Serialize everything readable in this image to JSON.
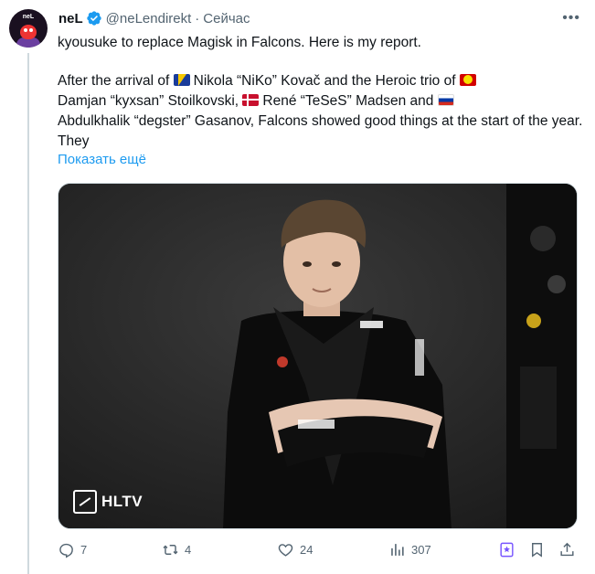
{
  "author": {
    "display_name": "neL",
    "handle": "@neLendirekt",
    "separator": "·",
    "timestamp": "Сейчас",
    "avatar_text": "neL"
  },
  "tweet": {
    "line1": "kyousuke to replace Magisk in Falcons. Here is my report.",
    "para_pre_flag1": "After the arrival of",
    "para_niko": "Nikola “NiKo” Kovač and the Heroic trio of",
    "para_kyxsan": "Damjan “kyxsan” Stoilkovski,",
    "para_teses": "René “TeSeS” Madsen and",
    "para_degster": "Abdulkhalik “degster” Gasanov, Falcons showed good things at the start of the year. They",
    "flags": [
      "bosnia-flag",
      "north-macedonia-flag",
      "denmark-flag",
      "russia-flag"
    ],
    "show_more": "Показать ещё"
  },
  "media": {
    "watermark": "HLTV",
    "description_icon": "photo"
  },
  "actions": {
    "replies": "7",
    "reposts": "4",
    "likes": "24",
    "views": "307"
  },
  "colors": {
    "accent": "#1d9bf0",
    "text": "#0f1419",
    "muted": "#536471",
    "grok": "#7856ff"
  }
}
